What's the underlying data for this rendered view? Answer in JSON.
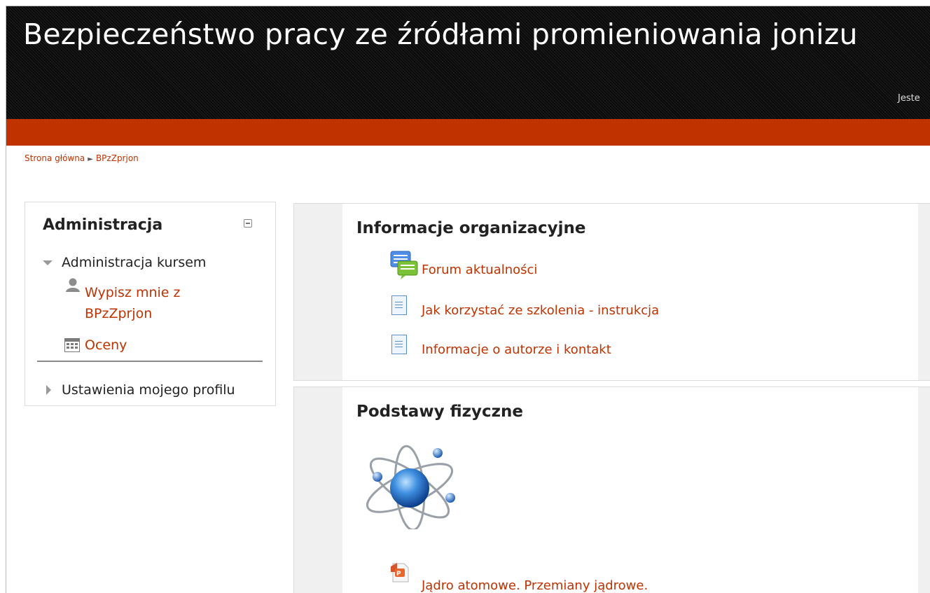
{
  "header": {
    "site_title": "Bezpieczeństwo pracy ze źródłami promieniowania jonizu",
    "login_info": "Jeste"
  },
  "breadcrumb": {
    "home": "Strona główna",
    "separator": "►",
    "course": "BPzZprjon"
  },
  "admin_block": {
    "title": "Administracja",
    "course_admin_label": "Administracja kursem",
    "unenrol_line1": "Wypisz mnie z",
    "unenrol_line2": "BPzZprjon",
    "grades_label": "Oceny",
    "profile_settings_label": "Ustawienia mojego profilu"
  },
  "sections": [
    {
      "title": "Informacje organizacyjne",
      "activities": [
        {
          "label": "Forum aktualności",
          "icon": "forum-icon"
        },
        {
          "label": "Jak korzystać ze szkolenia - instrukcja",
          "icon": "page-icon"
        },
        {
          "label": "Informacje o autorze i kontakt",
          "icon": "page-icon"
        }
      ]
    },
    {
      "title": "Podstawy fizyczne",
      "image": "atom-icon",
      "activities": [
        {
          "label": "Jądro atomowe. Przemiany jądrowe.",
          "icon": "powerpoint-icon"
        }
      ]
    }
  ],
  "colors": {
    "accent": "#c03200",
    "header_bg": "#111111",
    "section_bg": "#f0f0f0"
  }
}
